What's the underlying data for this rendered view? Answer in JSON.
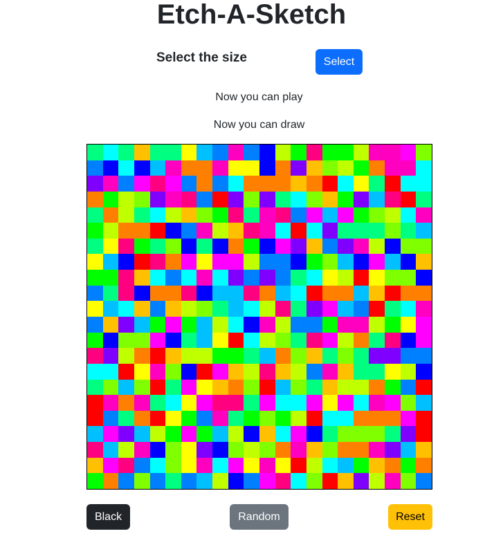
{
  "header": {
    "title": "Etch-A-Sketch"
  },
  "size_control": {
    "label": "Select the size",
    "button_label": "Select"
  },
  "status": {
    "play_message": "Now you can play",
    "draw_message": "Now you can draw"
  },
  "grid": {
    "columns": 22,
    "rows": 22,
    "palette": [
      "#ff0000",
      "#ff00ff",
      "#ffff00",
      "#00ff00",
      "#00ffff",
      "#0000ff",
      "#ff8000",
      "#80ff00",
      "#8000ff",
      "#ff0080",
      "#00ff80",
      "#0080ff",
      "#c0ff00",
      "#ff00c0",
      "#00c0ff",
      "#ffc000"
    ],
    "border_color": "#000000"
  },
  "controls": {
    "black_label": "Black",
    "random_label": "Random",
    "reset_label": "Reset"
  },
  "colors": {
    "primary": "#0d6efd",
    "dark": "#212529",
    "secondary": "#6c757d",
    "warning": "#ffc107"
  }
}
